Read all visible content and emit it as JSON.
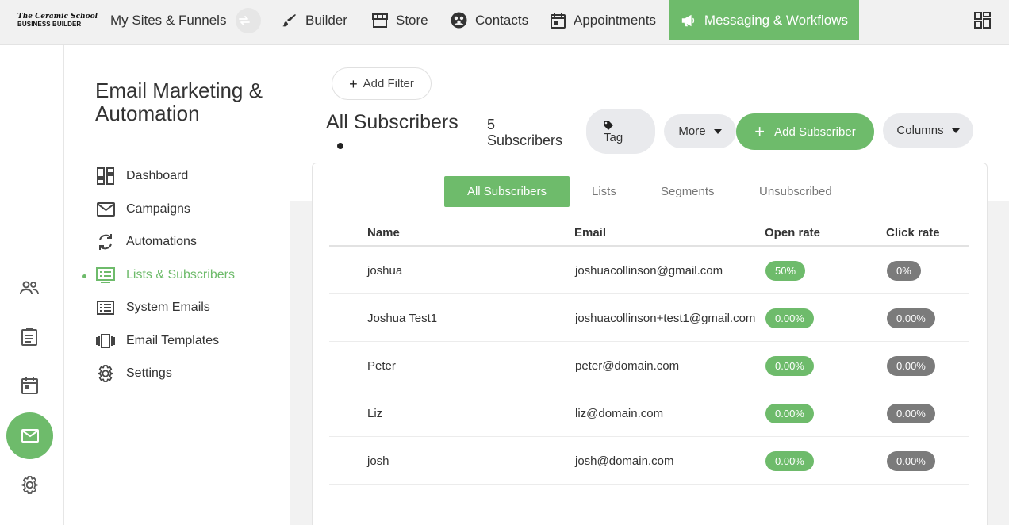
{
  "brand": {
    "logo_line1": "The Ceramic School",
    "logo_line2": "BUSINESS BUILDER"
  },
  "topnav": {
    "sites": "My Sites & Funnels",
    "builder": "Builder",
    "store": "Store",
    "contacts": "Contacts",
    "appointments": "Appointments",
    "messaging": "Messaging & Workflows"
  },
  "sidebar": {
    "title": "Email Marketing & Automation",
    "items": [
      {
        "label": "Dashboard",
        "icon": "dashboard-icon"
      },
      {
        "label": "Campaigns",
        "icon": "envelope-icon"
      },
      {
        "label": "Automations",
        "icon": "refresh-icon"
      },
      {
        "label": "Lists & Subscribers",
        "icon": "list-icon",
        "active": true
      },
      {
        "label": "System Emails",
        "icon": "list-alt-icon"
      },
      {
        "label": "Email Templates",
        "icon": "templates-icon"
      },
      {
        "label": "Settings",
        "icon": "gear-icon"
      }
    ]
  },
  "toolbar": {
    "add_filter": "Add Filter",
    "page_title": "All Subscribers",
    "count_number": "5",
    "count_label": "Subscribers",
    "tag_label": "Tag",
    "more_label": "More",
    "add_subscriber_label": "Add Subscriber",
    "columns_label": "Columns"
  },
  "tabs": [
    "All Subscribers",
    "Lists",
    "Segments",
    "Unsubscribed"
  ],
  "table": {
    "columns": [
      "Name",
      "Email",
      "Open rate",
      "Click rate"
    ],
    "rows": [
      {
        "name": "joshua",
        "email": "joshuacollinson@gmail.com",
        "open": "50%",
        "click": "0%"
      },
      {
        "name": "Joshua Test1",
        "email": "joshuacollinson+test1@gmail.com",
        "open": "0.00%",
        "click": "0.00%"
      },
      {
        "name": "Peter",
        "email": "peter@domain.com",
        "open": "0.00%",
        "click": "0.00%"
      },
      {
        "name": "Liz",
        "email": "liz@domain.com",
        "open": "0.00%",
        "click": "0.00%"
      },
      {
        "name": "josh",
        "email": "josh@domain.com",
        "open": "0.00%",
        "click": "0.00%"
      }
    ]
  },
  "colors": {
    "accent": "#6ebb6b",
    "badge_gray": "#7b7b7b"
  }
}
